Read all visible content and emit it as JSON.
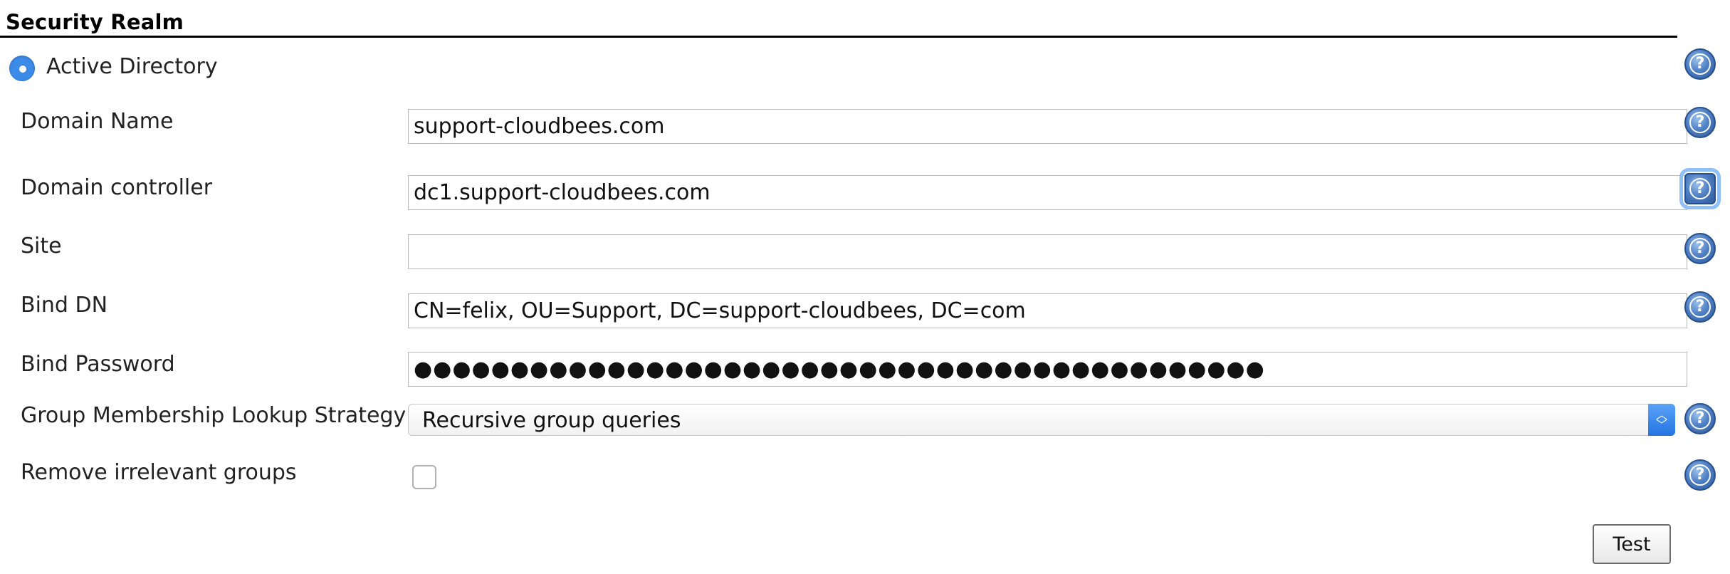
{
  "section": {
    "title": "Security Realm"
  },
  "realm": {
    "label": "Active Directory",
    "selected": true
  },
  "fields": {
    "domain_name": {
      "label": "Domain Name",
      "value": "support-cloudbees.com"
    },
    "domain_controller": {
      "label": "Domain controller",
      "value": "dc1.support-cloudbees.com"
    },
    "site": {
      "label": "Site",
      "value": ""
    },
    "bind_dn": {
      "label": "Bind DN",
      "value": "CN=felix, OU=Support, DC=support-cloudbees, DC=com"
    },
    "bind_password": {
      "label": "Bind Password",
      "value": "●●●●●●●●●●●●●●●●●●●●●●●●●●●●●●●●●●●●●●●●●●●●"
    },
    "group_lookup": {
      "label": "Group Membership Lookup Strategy",
      "value": "Recursive group queries"
    },
    "remove_groups": {
      "label": "Remove irrelevant groups",
      "checked": false
    }
  },
  "help_icon": {
    "glyph": "?"
  },
  "actions": {
    "test_label": "Test"
  },
  "colors": {
    "radio_accent": "#3d8be8",
    "select_accent": "#2474e3",
    "help_blue": "#4f7fc4"
  }
}
